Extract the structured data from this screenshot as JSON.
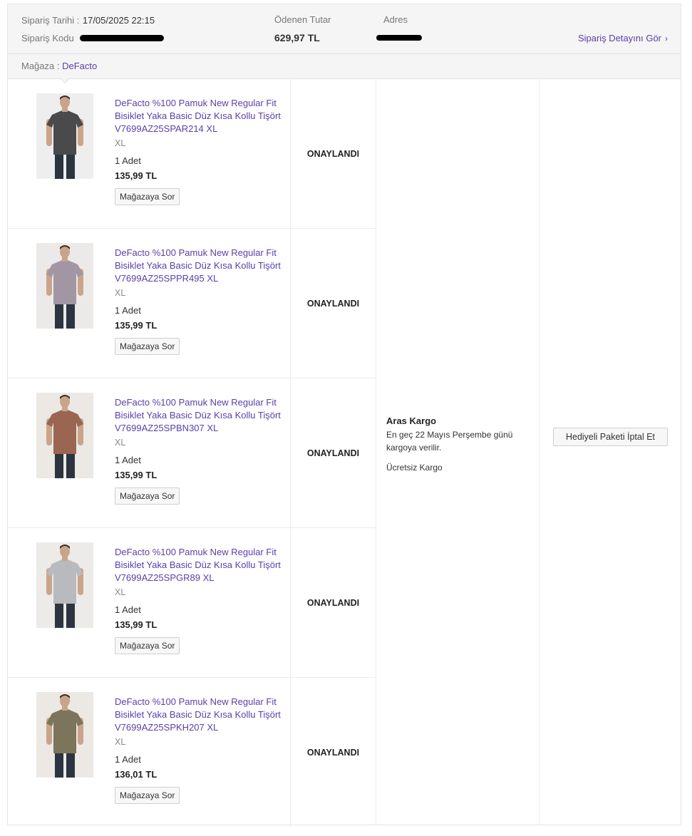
{
  "header": {
    "date_label": "Sipariş Tarihi :",
    "date_value": "17/05/2025 22:15",
    "code_label": "Sipariş Kodu",
    "paid_label": "Ödenen Tutar",
    "paid_value": "629,97 TL",
    "address_label": "Adres",
    "detail_link": "Sipariş Detayını Gör",
    "detail_icon": "chevron-right-icon"
  },
  "store": {
    "label": "Mağaza :",
    "name": "DeFacto"
  },
  "items": [
    {
      "name": "DeFacto %100 Pamuk New Regular Fit Bisiklet Yaka Basic Düz Kısa Kollu Tişört V7699AZ25SPAR214 XL",
      "size": "XL",
      "qty": "1 Adet",
      "price": "135,99 TL",
      "ask": "Mağazaya Sor",
      "status": "ONAYLANDI",
      "shirt_color": "#4a4a4c",
      "bg_color": "#eeeeee"
    },
    {
      "name": "DeFacto %100 Pamuk New Regular Fit Bisiklet Yaka Basic Düz Kısa Kollu Tişört V7699AZ25SPPR495 XL",
      "size": "XL",
      "qty": "1 Adet",
      "price": "135,99 TL",
      "ask": "Mağazaya Sor",
      "status": "ONAYLANDI",
      "shirt_color": "#a296a4",
      "bg_color": "#eceae8"
    },
    {
      "name": "DeFacto %100 Pamuk New Regular Fit Bisiklet Yaka Basic Düz Kısa Kollu Tişört V7699AZ25SPBN307 XL",
      "size": "XL",
      "qty": "1 Adet",
      "price": "135,99 TL",
      "ask": "Mağazaya Sor",
      "status": "ONAYLANDI",
      "shirt_color": "#9a6651",
      "bg_color": "#ece8e4"
    },
    {
      "name": "DeFacto %100 Pamuk New Regular Fit Bisiklet Yaka Basic Düz Kısa Kollu Tişört V7699AZ25SPGR89 XL",
      "size": "XL",
      "qty": "1 Adet",
      "price": "135,99 TL",
      "ask": "Mağazaya Sor",
      "status": "ONAYLANDI",
      "shirt_color": "#b9babd",
      "bg_color": "#ecebe8"
    },
    {
      "name": "DeFacto %100 Pamuk New Regular Fit Bisiklet Yaka Basic Düz Kısa Kollu Tişört V7699AZ25SPKH207 XL",
      "size": "XL",
      "qty": "1 Adet",
      "price": "136,01 TL",
      "ask": "Mağazaya Sor",
      "status": "ONAYLANDI",
      "shirt_color": "#7c745b",
      "bg_color": "#ece9e4"
    }
  ],
  "cargo": {
    "name": "Aras Kargo",
    "desc": "En geç 22 Mayıs Perşembe günü kargoya verilir.",
    "free": "Ücretsiz Kargo"
  },
  "gift_cancel": "Hediyeli Paketi İptal Et",
  "colors": {
    "accent": "#5a3fa8",
    "header_bg": "#f5f5f5",
    "border": "#e5e5e5"
  }
}
